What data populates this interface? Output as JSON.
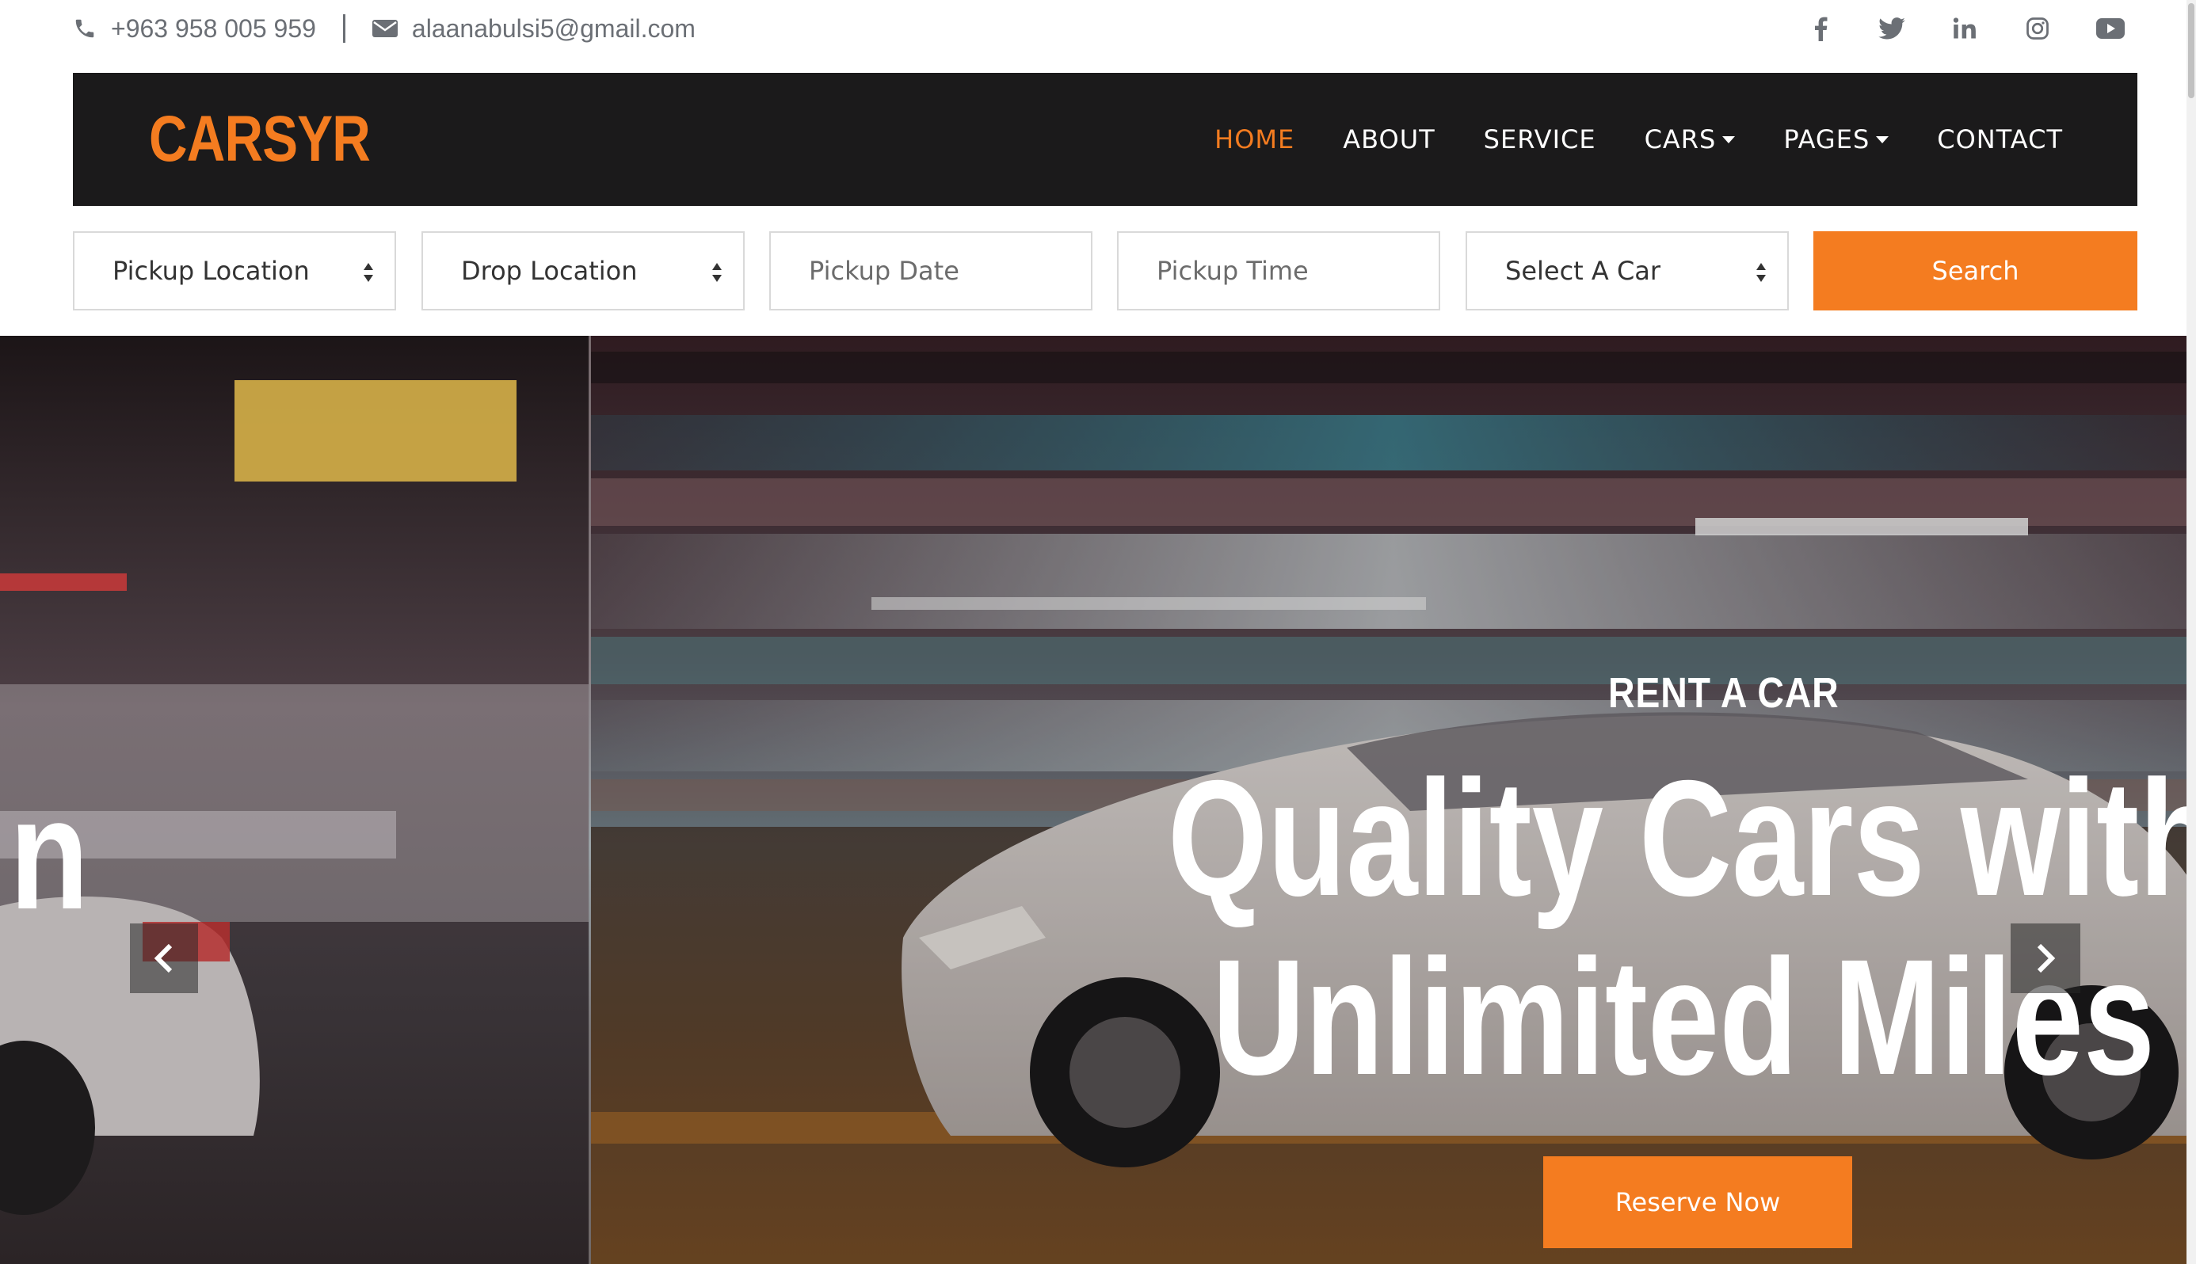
{
  "topbar": {
    "phone": "+963 958 005 959",
    "email": "alaanabulsi5@gmail.com",
    "socials": [
      "facebook-icon",
      "twitter-icon",
      "linkedin-icon",
      "instagram-icon",
      "youtube-icon"
    ],
    "icon_color": "#6b6f75"
  },
  "navbar": {
    "brand": "CARSYR",
    "items": [
      {
        "label": "HOME",
        "active": true
      },
      {
        "label": "ABOUT"
      },
      {
        "label": "SERVICE"
      },
      {
        "label": "CARS",
        "dropdown": true
      },
      {
        "label": "PAGES",
        "dropdown": true
      },
      {
        "label": "CONTACT"
      }
    ],
    "background": "#1b1a1b",
    "accent": "#f47c20"
  },
  "search": {
    "pickup_location": "Pickup Location",
    "drop_location": "Drop Location",
    "pickup_date_placeholder": "Pickup Date",
    "pickup_time_placeholder": "Pickup Time",
    "select_car": "Select A Car",
    "button": "Search"
  },
  "hero": {
    "subtitle": "RENT A CAR",
    "title_line1": "Quality Cars with",
    "title_line2": "Unlimited Miles",
    "left_fragment": "n",
    "cta": "Reserve Now"
  }
}
